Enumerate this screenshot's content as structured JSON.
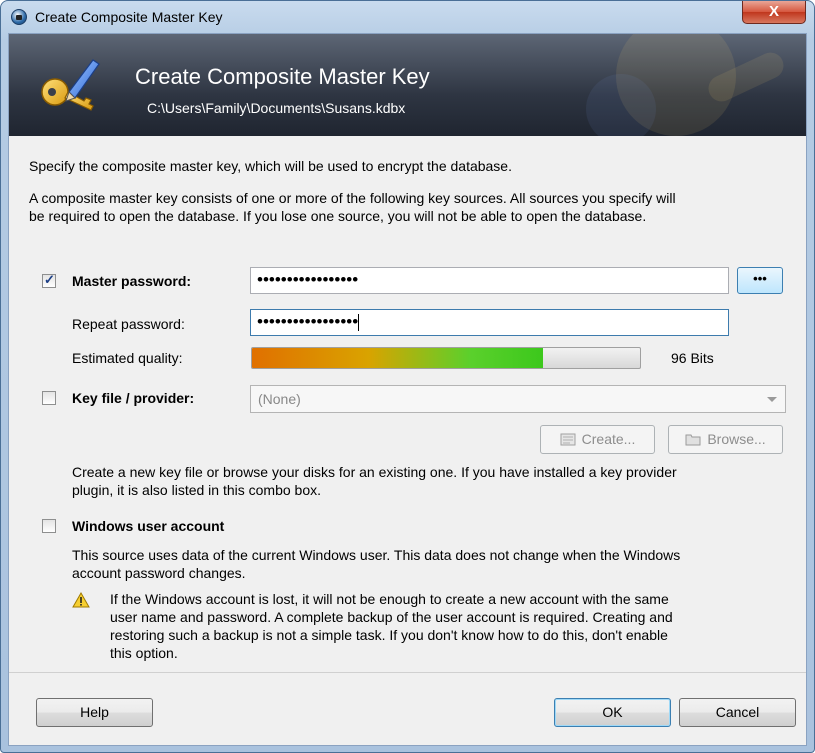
{
  "window": {
    "title": "Create Composite Master Key",
    "close_label": "X"
  },
  "banner": {
    "title": "Create Composite Master Key",
    "path": "C:\\Users\\Family\\Documents\\Susans.kdbx"
  },
  "intro": {
    "line1": "Specify the composite master key, which will be used to encrypt the database.",
    "line2a": "A composite master key consists of one or more of the following key sources. All sources you specify will",
    "line2b": "be required to open the database.  If you lose one source, you will not be able to open the database."
  },
  "master_password": {
    "checked": true,
    "label": "Master password:",
    "value": "•••••••••••••••••",
    "toggle_label": "•••",
    "repeat_label": "Repeat password:",
    "repeat_value": "•••••••••••••••••",
    "quality_label": "Estimated quality:",
    "quality_fraction": 0.75,
    "quality_text": "96 Bits"
  },
  "key_file": {
    "checked": false,
    "label": "Key file / provider:",
    "selected": "(None)",
    "create_label": "Create...",
    "browse_label": "Browse...",
    "help_a": "Create a new key file or browse your disks for an existing one. If you have installed a key provider",
    "help_b": "plugin, it is also listed in this combo box."
  },
  "windows_account": {
    "checked": false,
    "label": "Windows user account",
    "desc_a": "This source uses data of the current Windows user. This data does not change when the Windows",
    "desc_b": "account password changes.",
    "warn_a": "If the Windows account is lost, it will not be enough to create a new account with the same",
    "warn_b": "user name and password. A complete backup of the user account is required. Creating and",
    "warn_c": "restoring such a backup is not a simple task. If you don't know how to do this, don't enable",
    "warn_d": "this option."
  },
  "footer": {
    "help": "Help",
    "ok": "OK",
    "cancel": "Cancel"
  },
  "colors": {
    "accent": "#3c7fb1",
    "banner": "#2e3542",
    "quality_start": "#e07000",
    "quality_end": "#3cc81c"
  }
}
